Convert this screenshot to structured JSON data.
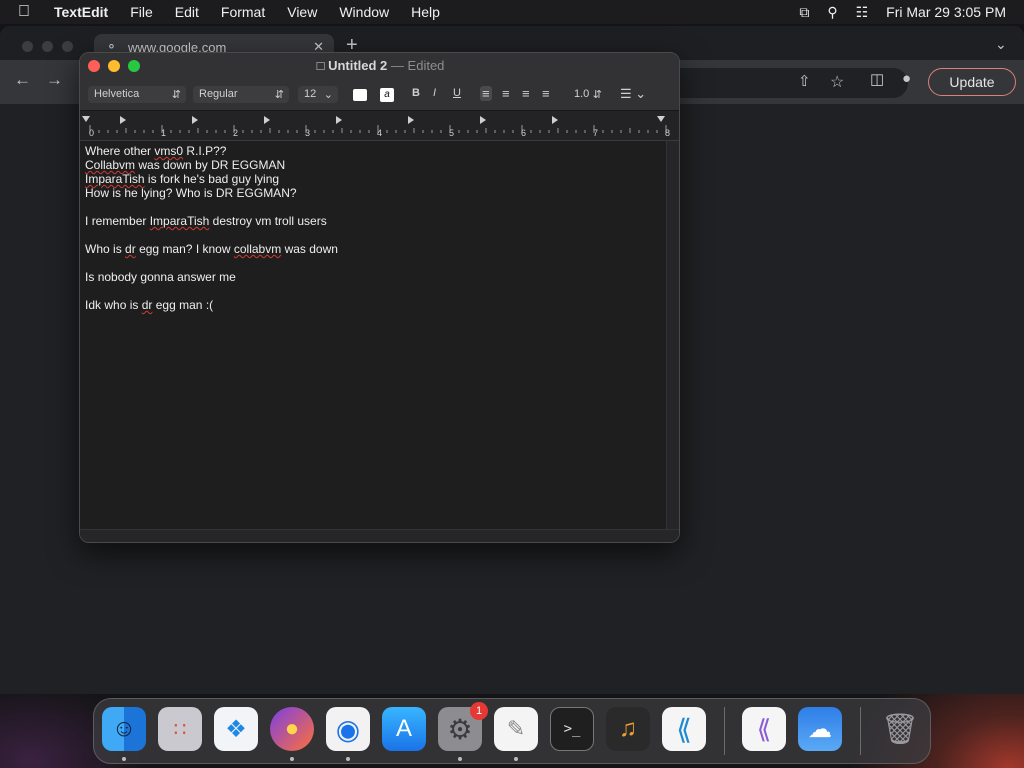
{
  "menubar": {
    "apple_icon": "apple-icon",
    "app_name": "TextEdit",
    "items": [
      "File",
      "Edit",
      "Format",
      "View",
      "Window",
      "Help"
    ],
    "clock": "Fri Mar 29  3:05 PM"
  },
  "browser": {
    "tab_title": "www.google.com",
    "update_label": "Update"
  },
  "textedit": {
    "title": "Untitled 2",
    "status": "Edited",
    "font_family": "Helvetica",
    "font_style": "Regular",
    "font_size": "12",
    "line_spacing": "1.0",
    "bold_label": "B",
    "italic_label": "I",
    "underline_label": "U",
    "ruler_labels": [
      "0",
      "1",
      "2",
      "3",
      "4",
      "5",
      "6",
      "7",
      "8"
    ],
    "lines": [
      "Where other vms0 R.I.P??",
      "Collabvm was down by DR EGGMAN",
      "ImparaTish is fork he's bad guy lying",
      "How is he lying? Who is DR EGGMAN?",
      "",
      "I remember ImparaTish destroy vm troll users",
      "",
      "Who is dr egg man? I know collabvm was down",
      "",
      "Is nobody gonna answer me",
      "",
      "Idk who is dr egg man :("
    ]
  },
  "dock": {
    "items": [
      "finder",
      "launchpad",
      "safari",
      "firefox",
      "chrome",
      "app-store",
      "system-settings",
      "textedit",
      "terminal",
      "garageband",
      "vscode",
      "visual-studio",
      "weather",
      "trash"
    ],
    "settings_badge": "1"
  }
}
